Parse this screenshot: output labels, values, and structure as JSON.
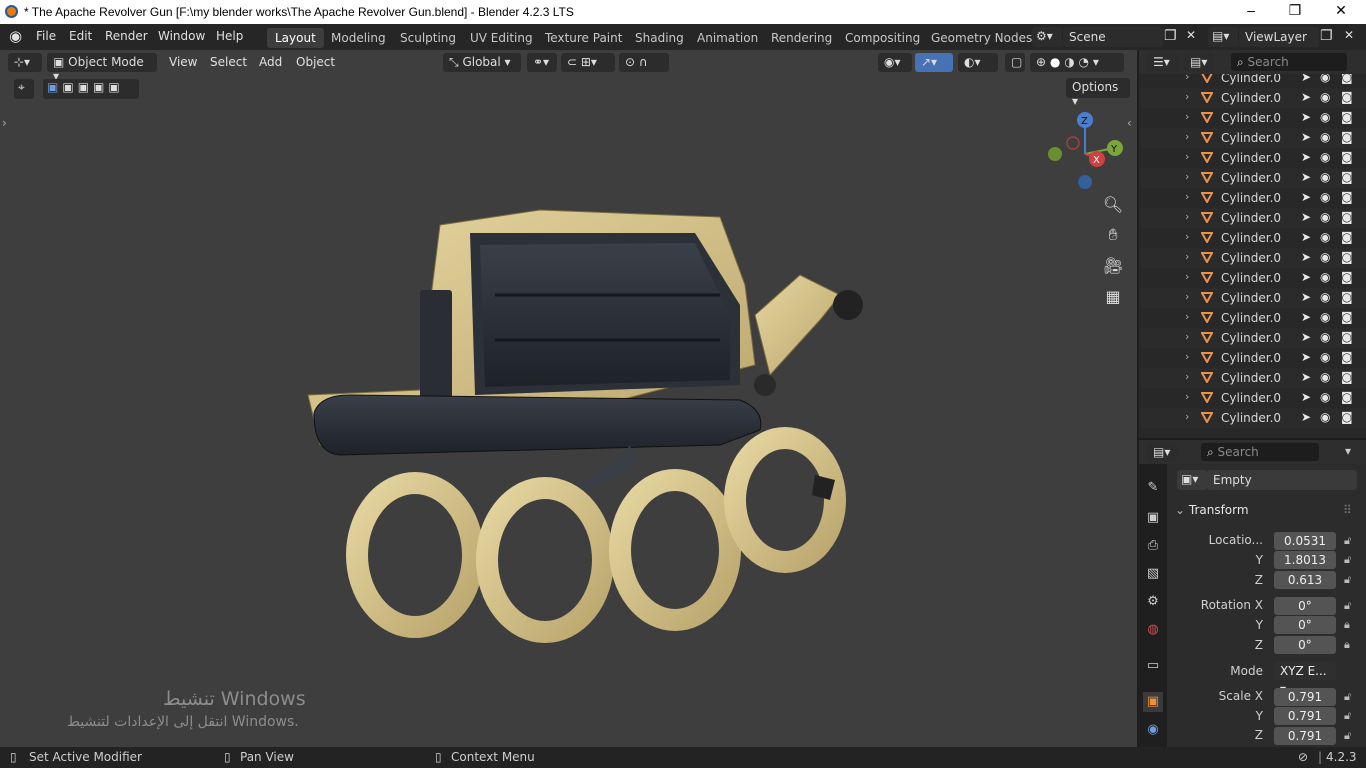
{
  "window": {
    "title": "* The Apache Revolver Gun [F:\\my blender works\\The Apache Revolver Gun.blend] - Blender 4.2.3 LTS",
    "min": "–",
    "max": "❐",
    "close": "✕"
  },
  "menu": {
    "items": [
      "File",
      "Edit",
      "Render",
      "Window",
      "Help"
    ],
    "workspaces": [
      "Layout",
      "Modeling",
      "Sculpting",
      "UV Editing",
      "Texture Paint",
      "Shading",
      "Animation",
      "Rendering",
      "Compositing",
      "Geometry Nodes"
    ],
    "active_workspace": "Layout",
    "scene": "Scene",
    "view_layer": "ViewLayer"
  },
  "viewport_header": {
    "mode": "Object Mode",
    "menus": [
      "View",
      "Select",
      "Add",
      "Object"
    ],
    "orientation": "Global",
    "options": "Options"
  },
  "gizmo": {
    "z": "Z",
    "y": "Y",
    "x": "X"
  },
  "watermark": {
    "line1": "تنشيط Windows",
    "line2": "انتقل إلى الإعدادات لتنشيط Windows."
  },
  "outliner": {
    "search_placeholder": "Search",
    "rows": [
      "Cylinder.0",
      "Cylinder.0",
      "Cylinder.0",
      "Cylinder.0",
      "Cylinder.0",
      "Cylinder.0",
      "Cylinder.0",
      "Cylinder.0",
      "Cylinder.0",
      "Cylinder.0",
      "Cylinder.0",
      "Cylinder.0",
      "Cylinder.0",
      "Cylinder.0",
      "Cylinder.0",
      "Cylinder.0",
      "Cylinder.0",
      "Cylinder.0"
    ]
  },
  "properties": {
    "search_placeholder": "Search",
    "object_name": "Empty",
    "panel_title": "Transform",
    "location_label": "Locatio...",
    "location": [
      "0.0531",
      "1.8013",
      "0.613"
    ],
    "rotation_label": "Rotation X",
    "rotation": [
      "0°",
      "0°",
      "0°"
    ],
    "mode_label": "Mode",
    "mode_value": "XYZ E...",
    "scale_label": "Scale X",
    "scale": [
      "0.791",
      "0.791",
      "0.791"
    ],
    "axis_y": "Y",
    "axis_z": "Z"
  },
  "statusbar": {
    "left": "Set Active Modifier",
    "middle": "Pan View",
    "right": "Context Menu",
    "version": "4.2.3"
  },
  "colors": {
    "accent": "#4772b3",
    "object_orange": "#e8924a",
    "brass": "#d8c58e",
    "steel": "#2a2f38"
  }
}
